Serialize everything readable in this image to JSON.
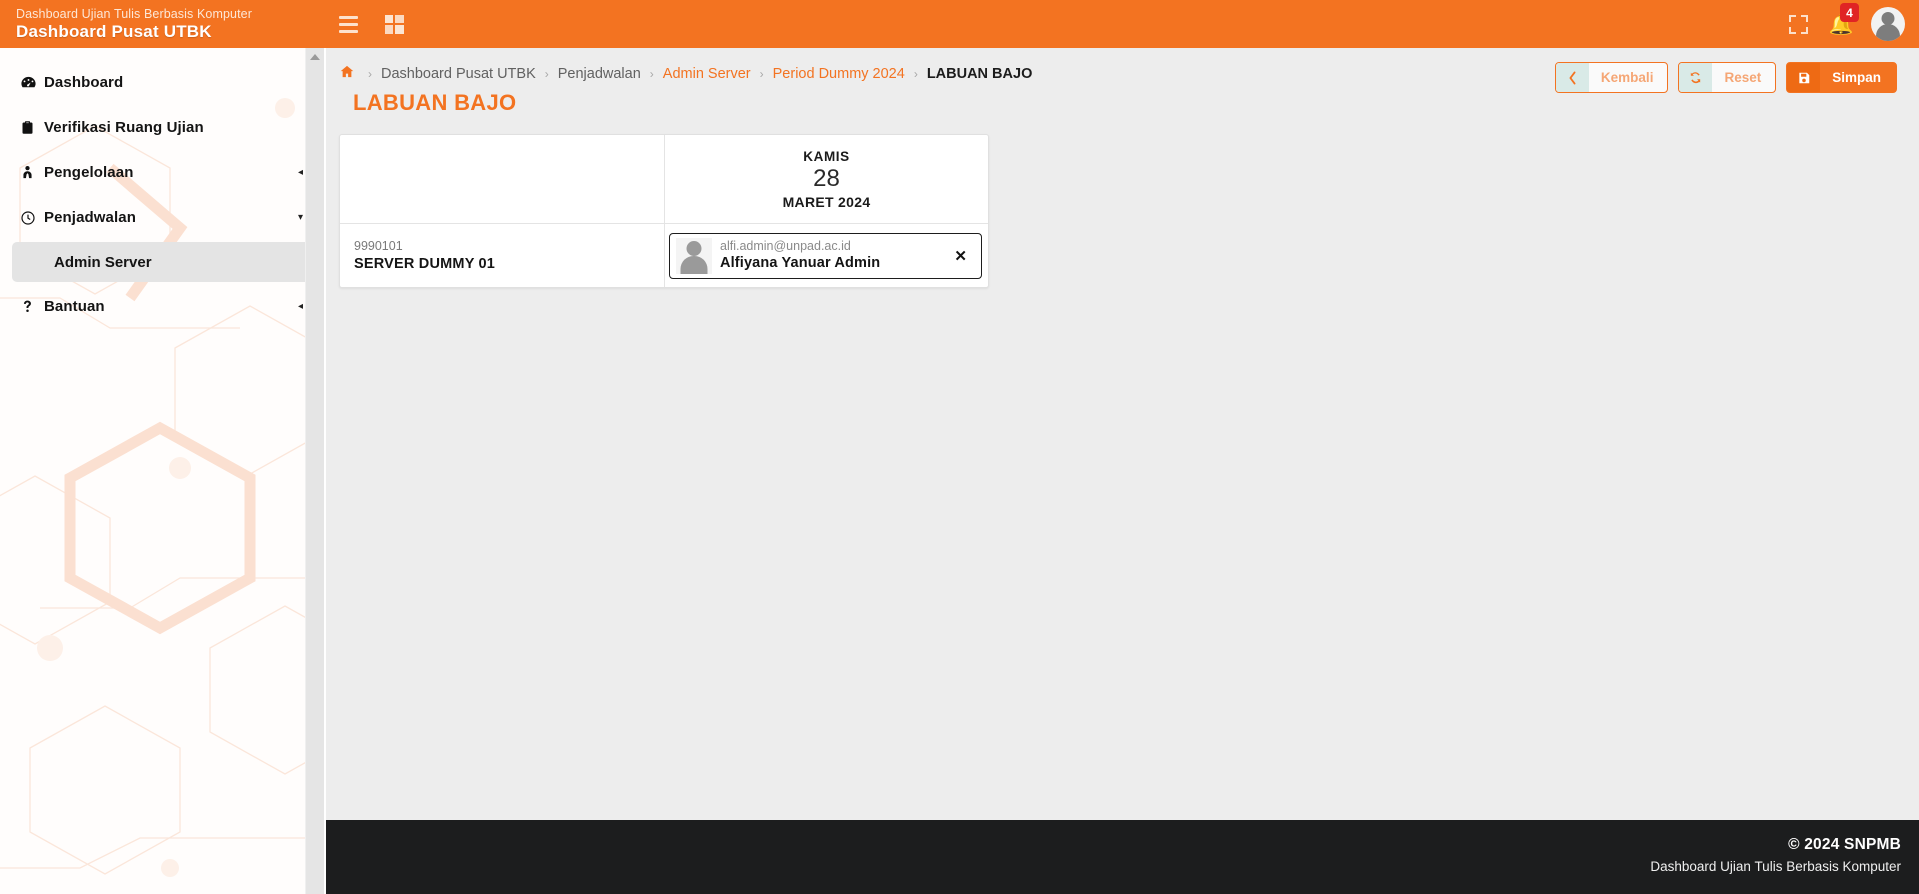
{
  "header": {
    "brand_subtitle": "Dashboard Ujian Tulis Berbasis Komputer",
    "brand_title": "Dashboard Pusat UTBK",
    "menu_toggle_icon": "hamburger-icon",
    "grid_icon": "grid-icon",
    "fullscreen_icon": "fullscreen-icon",
    "bell_icon": "bell-icon",
    "notification_count": "4",
    "avatar_icon": "user-avatar-icon",
    "accent_color": "#f37321"
  },
  "sidebar": {
    "items": [
      {
        "label": "Dashboard",
        "icon": "speedometer-icon",
        "caret": "",
        "active": false
      },
      {
        "label": "Verifikasi Ruang Ujian",
        "icon": "clipboard-check-icon",
        "caret": "",
        "active": false
      },
      {
        "label": "Pengelolaan",
        "icon": "user-tie-icon",
        "caret": "◂",
        "active": false
      },
      {
        "label": "Penjadwalan",
        "icon": "clock-icon",
        "caret": "▾",
        "active": false
      }
    ],
    "submenu": [
      {
        "label": "Admin Server",
        "active": true
      }
    ],
    "items_after": [
      {
        "label": "Bantuan",
        "icon": "question-icon",
        "caret": "◂",
        "active": false
      }
    ]
  },
  "breadcrumb": {
    "home_icon": "home-icon",
    "separator": "›",
    "trail": [
      {
        "label": "Dashboard Pusat UTBK",
        "type": "plain"
      },
      {
        "label": "Penjadwalan",
        "type": "plain"
      },
      {
        "label": "Admin Server",
        "type": "link"
      },
      {
        "label": "Period Dummy 2024",
        "type": "link"
      },
      {
        "label": "LABUAN BAJO",
        "type": "current"
      }
    ]
  },
  "page": {
    "title": "LABUAN BAJO"
  },
  "toolbar": {
    "back_label": "Kembali",
    "back_icon": "chevron-left-icon",
    "reset_label": "Reset",
    "reset_icon": "refresh-icon",
    "save_label": "Simpan",
    "save_icon": "floppy-disk-icon"
  },
  "schedule": {
    "date_column": {
      "day_name": "KAMIS",
      "day_number": "28",
      "month_year": "MARET 2024"
    },
    "server": {
      "id": "9990101",
      "name": "SERVER DUMMY 01"
    },
    "assignment": {
      "email": "alfi.admin@unpad.ac.id",
      "name": "Alfiyana Yanuar Admin",
      "avatar_icon": "user-avatar-icon",
      "remove_icon": "close-x-icon"
    }
  },
  "footer": {
    "copyright": "© 2024 SNPMB",
    "tagline": "Dashboard Ujian Tulis Berbasis Komputer"
  }
}
